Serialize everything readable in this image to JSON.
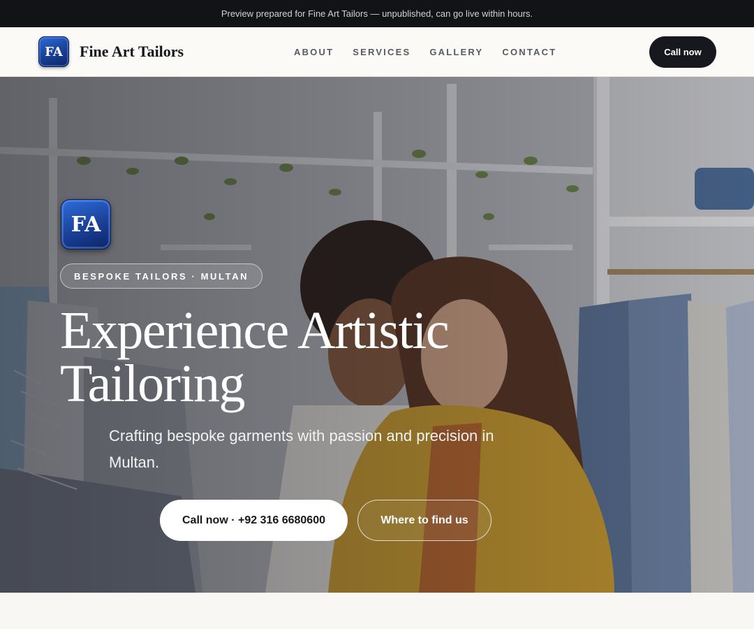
{
  "preview_banner": {
    "text": "Preview prepared for Fine Art Tailors — unpublished, can go live within hours."
  },
  "header": {
    "logo_text": "FA",
    "brand_name": "Fine Art Tailors",
    "nav": [
      "ABOUT",
      "SERVICES",
      "GALLERY",
      "CONTACT"
    ],
    "cta_label": "Call now"
  },
  "hero": {
    "logo_text": "FA",
    "tag": "BESPOKE TAILORS · MULTAN",
    "title": "Experience Artistic Tailoring",
    "subtitle": "Crafting bespoke garments with passion and precision in Multan.",
    "primary_button": "Call now · +92 316 6680600",
    "secondary_button": "Where to find us"
  },
  "colors": {
    "dark": "#16181d",
    "logo_blue": "#1b4199",
    "page_bg": "#f8f7f4"
  }
}
